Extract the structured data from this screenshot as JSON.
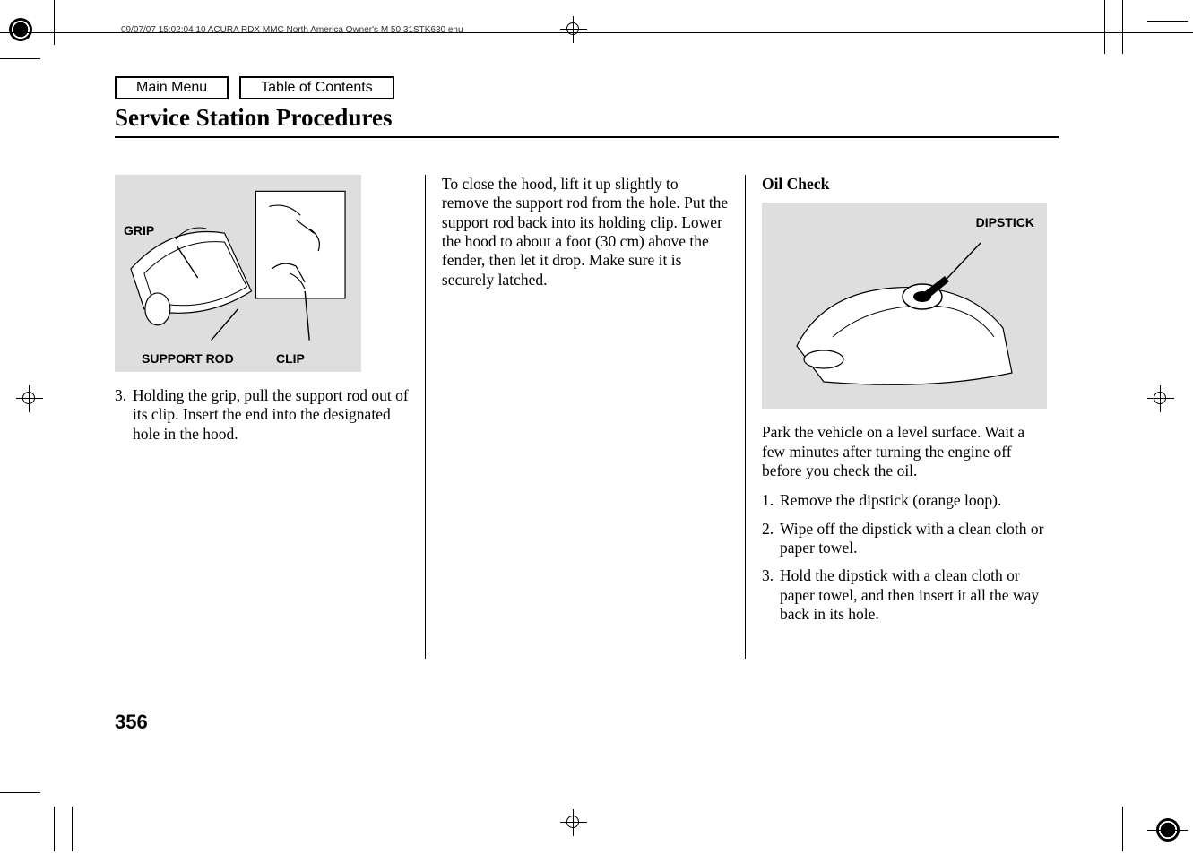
{
  "header": {
    "metadata": "09/07/07 15:02:04   10 ACURA RDX MMC North America Owner's M 50 31STK630 enu"
  },
  "nav": {
    "main_menu": "Main Menu",
    "toc": "Table of Contents"
  },
  "title": "Service Station Procedures",
  "column1": {
    "fig_labels": {
      "grip": "GRIP",
      "support_rod": "SUPPORT ROD",
      "clip": "CLIP"
    },
    "step3_num": "3.",
    "step3": "Holding the grip, pull the support rod out of its clip. Insert the end into the designated hole in the hood."
  },
  "column2": {
    "paragraph": "To close the hood, lift it up slightly to remove the support rod from the hole. Put the support rod back into its holding clip. Lower the hood to about a foot (30 cm) above the fender, then let it drop. Make sure it is securely latched."
  },
  "column3": {
    "heading": "Oil Check",
    "fig_labels": {
      "dipstick": "DIPSTICK"
    },
    "intro": "Park the vehicle on a level surface. Wait a few minutes after turning the engine off before you check the oil.",
    "step1_num": "1.",
    "step1": "Remove the dipstick (orange loop).",
    "step2_num": "2.",
    "step2": "Wipe off the dipstick with a clean cloth or paper towel.",
    "step3_num": "3.",
    "step3": "Hold the dipstick with a clean cloth or paper towel, and then insert it all the way back in its hole."
  },
  "page_number": "356"
}
